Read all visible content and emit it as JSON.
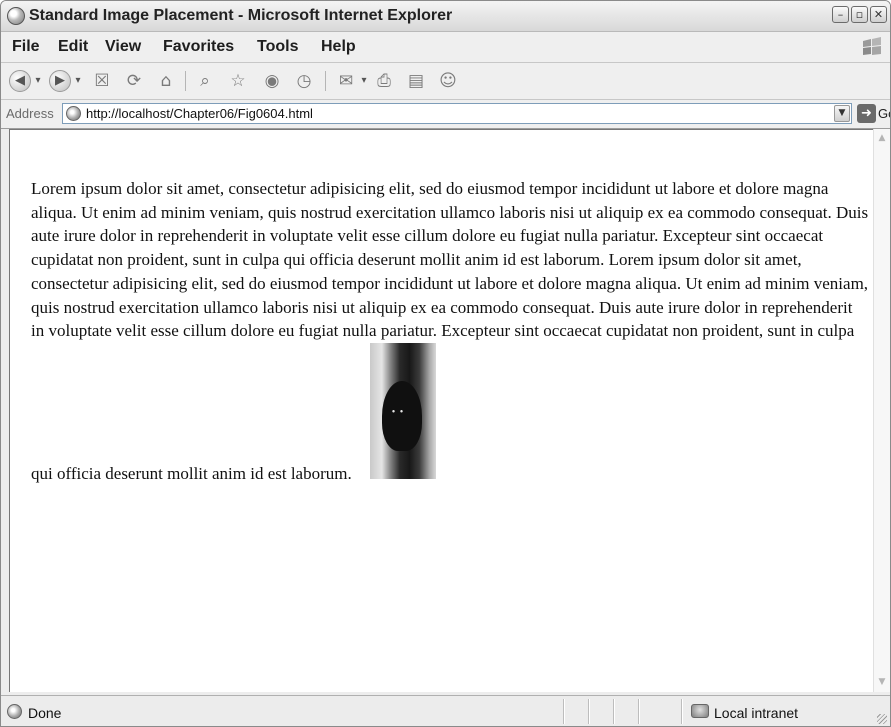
{
  "window": {
    "title": "Standard Image Placement - Microsoft Internet Explorer",
    "controls": [
      "minimize",
      "maximize",
      "close"
    ]
  },
  "menu": {
    "items": [
      "File",
      "Edit",
      "View",
      "Favorites",
      "Tools",
      "Help"
    ]
  },
  "toolbar": {
    "buttons": [
      "back-icon",
      "forward-icon",
      "stop-icon",
      "refresh-icon",
      "home-icon",
      "search-icon",
      "favorites-icon",
      "media-icon",
      "history-icon",
      "mail-icon",
      "print-icon",
      "edit-icon",
      "messenger-icon"
    ]
  },
  "address": {
    "label": "Address",
    "url": "http://localhost/Chapter06/Fig0604.html",
    "go_label": "Go"
  },
  "content": {
    "paragraph": "Lorem ipsum dolor sit amet, consectetur adipisicing elit, sed do eiusmod tempor incididunt ut labore et dolore magna aliqua. Ut enim ad minim veniam, quis nostrud exercitation ullamco laboris nisi ut aliquip ex ea commodo consequat. Duis aute irure dolor in reprehenderit in voluptate velit esse cillum dolore eu fugiat nulla pariatur. Excepteur sint occaecat cupidatat non proident, sunt in culpa qui officia deserunt mollit anim id est laborum. Lorem ipsum dolor sit amet, consectetur adipisicing elit, sed do eiusmod tempor incididunt ut labore et dolore magna aliqua. Ut enim ad minim veniam, quis nostrud exercitation ullamco laboris nisi ut aliquip ex ea commodo consequat. Duis aute irure dolor in reprehenderit in voluptate velit esse cillum dolore eu fugiat nulla pariatur. Excepteur sint occaecat cupidatat non proident, sunt in culpa qui officia deserunt mollit anim id est laborum.",
    "image": "cat-photo"
  },
  "status": {
    "text": "Done",
    "zone": "Local intranet"
  }
}
